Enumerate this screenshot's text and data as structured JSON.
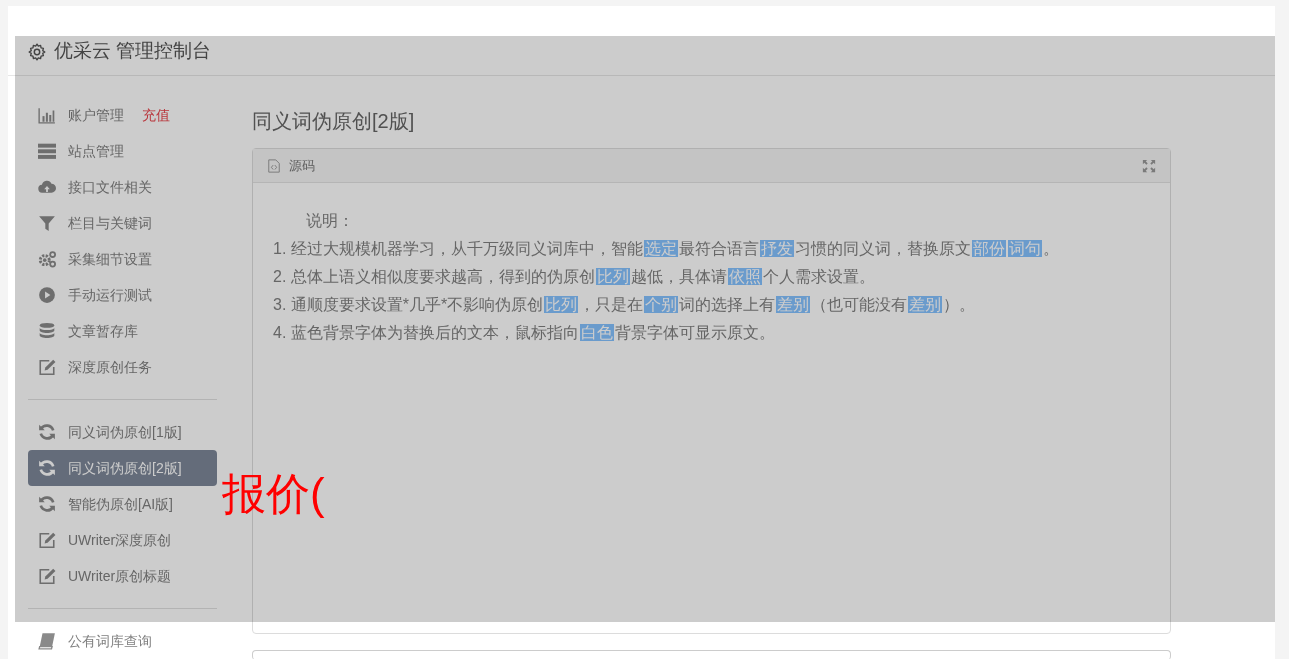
{
  "header": {
    "title": "优采云 管理控制台"
  },
  "sidebar": {
    "groups": [
      {
        "items": [
          {
            "label": "账户管理",
            "badge": "充值",
            "selected": false
          },
          {
            "label": "站点管理",
            "selected": false
          },
          {
            "label": "接口文件相关",
            "selected": false
          },
          {
            "label": "栏目与关键词",
            "selected": false
          },
          {
            "label": "采集细节设置",
            "selected": false
          },
          {
            "label": "手动运行测试",
            "selected": false
          },
          {
            "label": "文章暂存库",
            "selected": false
          },
          {
            "label": "深度原创任务",
            "selected": false
          }
        ]
      },
      {
        "items": [
          {
            "label": "同义词伪原创[1版]",
            "selected": false
          },
          {
            "label": "同义词伪原创[2版]",
            "selected": true
          },
          {
            "label": "智能伪原创[AI版]",
            "selected": false
          },
          {
            "label": "UWriter深度原创",
            "selected": false
          },
          {
            "label": "UWriter原创标题",
            "selected": false
          }
        ]
      },
      {
        "items": [
          {
            "label": "公有词库查询",
            "selected": false
          }
        ]
      }
    ]
  },
  "content": {
    "title": "同义词伪原创[2版]",
    "panel": {
      "title": "源码",
      "intro": "说明：",
      "lines": [
        {
          "number": "1.",
          "segments": [
            {
              "text": "经过大规模机器学习，从千万级同义词库中，智能",
              "highlighted": false
            },
            {
              "text": "选定",
              "highlighted": true
            },
            {
              "text": "最符合语言",
              "highlighted": false
            },
            {
              "text": "抒发",
              "highlighted": true
            },
            {
              "text": "习惯的同义词，替换原文",
              "highlighted": false
            },
            {
              "text": "部份",
              "highlighted": true
            },
            {
              "text": "词句",
              "highlighted": true
            },
            {
              "text": "。",
              "highlighted": false
            }
          ]
        },
        {
          "number": "2.",
          "segments": [
            {
              "text": "总体上语义相似度要求越高，得到的伪原创",
              "highlighted": false
            },
            {
              "text": "比列",
              "highlighted": true
            },
            {
              "text": "越低，具体请",
              "highlighted": false
            },
            {
              "text": "依照",
              "highlighted": true
            },
            {
              "text": "个人需求设置。",
              "highlighted": false
            }
          ]
        },
        {
          "number": "3.",
          "segments": [
            {
              "text": "通顺度要求设置*几乎*不影响伪原创",
              "highlighted": false
            },
            {
              "text": "比列",
              "highlighted": true
            },
            {
              "text": "，只是在",
              "highlighted": false
            },
            {
              "text": "个别",
              "highlighted": true
            },
            {
              "text": "词的选择上有",
              "highlighted": false
            },
            {
              "text": "差别",
              "highlighted": true
            },
            {
              "text": "（也可能没有",
              "highlighted": false
            },
            {
              "text": "差别",
              "highlighted": true
            },
            {
              "text": "）。",
              "highlighted": false
            }
          ]
        },
        {
          "number": "4.",
          "segments": [
            {
              "text": "蓝色背景字体为替换后的文本，鼠标指向",
              "highlighted": false
            },
            {
              "text": "白色",
              "highlighted": true
            },
            {
              "text": "背景字体可显示原文。",
              "highlighted": false
            }
          ]
        }
      ]
    }
  },
  "overlay": {
    "text": "报价("
  }
}
